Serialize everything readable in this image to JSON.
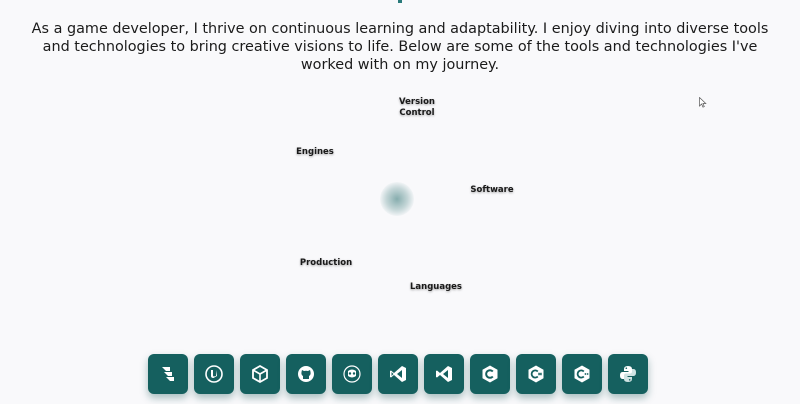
{
  "intro": {
    "text": "As a game developer, I thrive on continuous learning and adaptability. I enjoy diving into diverse tools and technologies to bring creative visions to life. Below are some of the tools and technologies I've worked with on my journey."
  },
  "categories": {
    "version_control": "Version Control",
    "engines": "Engines",
    "software": "Software",
    "production": "Production",
    "languages": "Languages"
  },
  "tools": [
    {
      "icon": "jira-icon"
    },
    {
      "icon": "unreal-engine-icon"
    },
    {
      "icon": "unity-icon"
    },
    {
      "icon": "github-icon"
    },
    {
      "icon": "godot-icon"
    },
    {
      "icon": "visual-studio-icon"
    },
    {
      "icon": "vscode-icon"
    },
    {
      "icon": "c-icon"
    },
    {
      "icon": "csharp-icon"
    },
    {
      "icon": "cpp-icon"
    },
    {
      "icon": "python-icon"
    }
  ],
  "colors": {
    "accent": "#15605f",
    "background": "#f9f9fb"
  }
}
